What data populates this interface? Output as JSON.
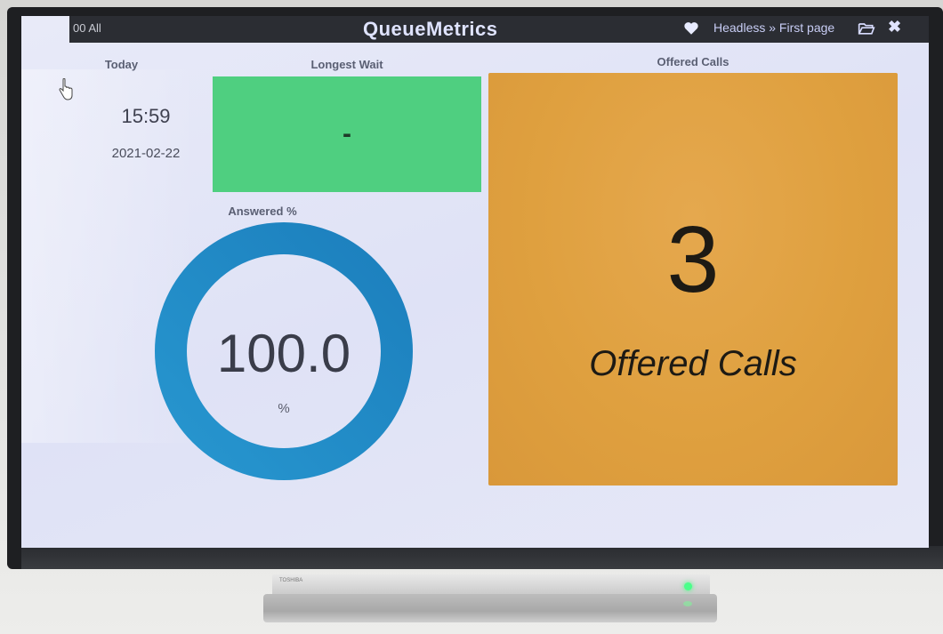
{
  "header": {
    "left_label": "00 All",
    "app_title": "QueueMetrics",
    "breadcrumb": "Headless » First page",
    "close_glyph": "✖"
  },
  "today": {
    "label": "Today",
    "time": "15:59",
    "date": "2021-02-22"
  },
  "longest_wait": {
    "label": "Longest Wait",
    "value": "-",
    "color": "#4fcf80"
  },
  "answered": {
    "label": "Answered %",
    "value": "100.0",
    "unit": "%",
    "percent": 100,
    "color": "#1f8cc6"
  },
  "offered": {
    "label": "Offered Calls",
    "value": "3",
    "caption": "Offered Calls",
    "color": "#e0a040"
  },
  "tv": {
    "brand": "TOSHIBA"
  },
  "icons": [
    "heart-icon",
    "folder-open-icon",
    "close-icon",
    "hand-pointer-icon"
  ]
}
